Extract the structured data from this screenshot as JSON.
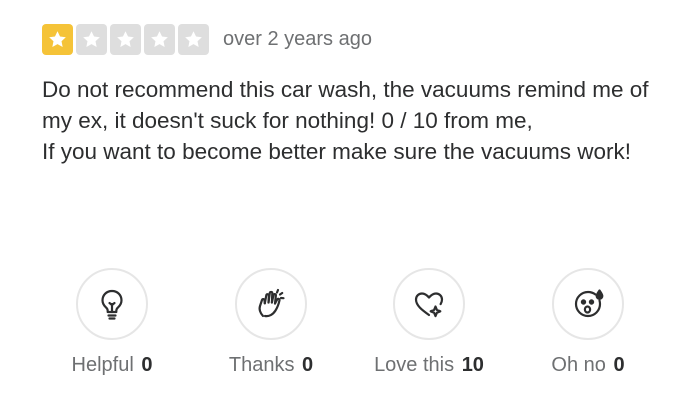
{
  "rating": {
    "value": 1,
    "max": 5,
    "filled_color": "#f5c338",
    "empty_color": "#dedede",
    "star_icon": "star-icon"
  },
  "review": {
    "date": "over 2 years ago",
    "lines": [
      "Do not recommend this car wash, the vacuums remind me of my ex, it doesn't suck for nothing! 0 / 10 from me,",
      "If you want to become better make sure the vacuums work!"
    ]
  },
  "reactions": [
    {
      "label": "Helpful",
      "count": "0",
      "icon": "lightbulb-icon"
    },
    {
      "label": "Thanks",
      "count": "0",
      "icon": "clapping-hands-icon"
    },
    {
      "label": "Love this",
      "count": "10",
      "icon": "heart-sparkle-icon"
    },
    {
      "label": "Oh no",
      "count": "0",
      "icon": "surprised-face-icon"
    }
  ]
}
